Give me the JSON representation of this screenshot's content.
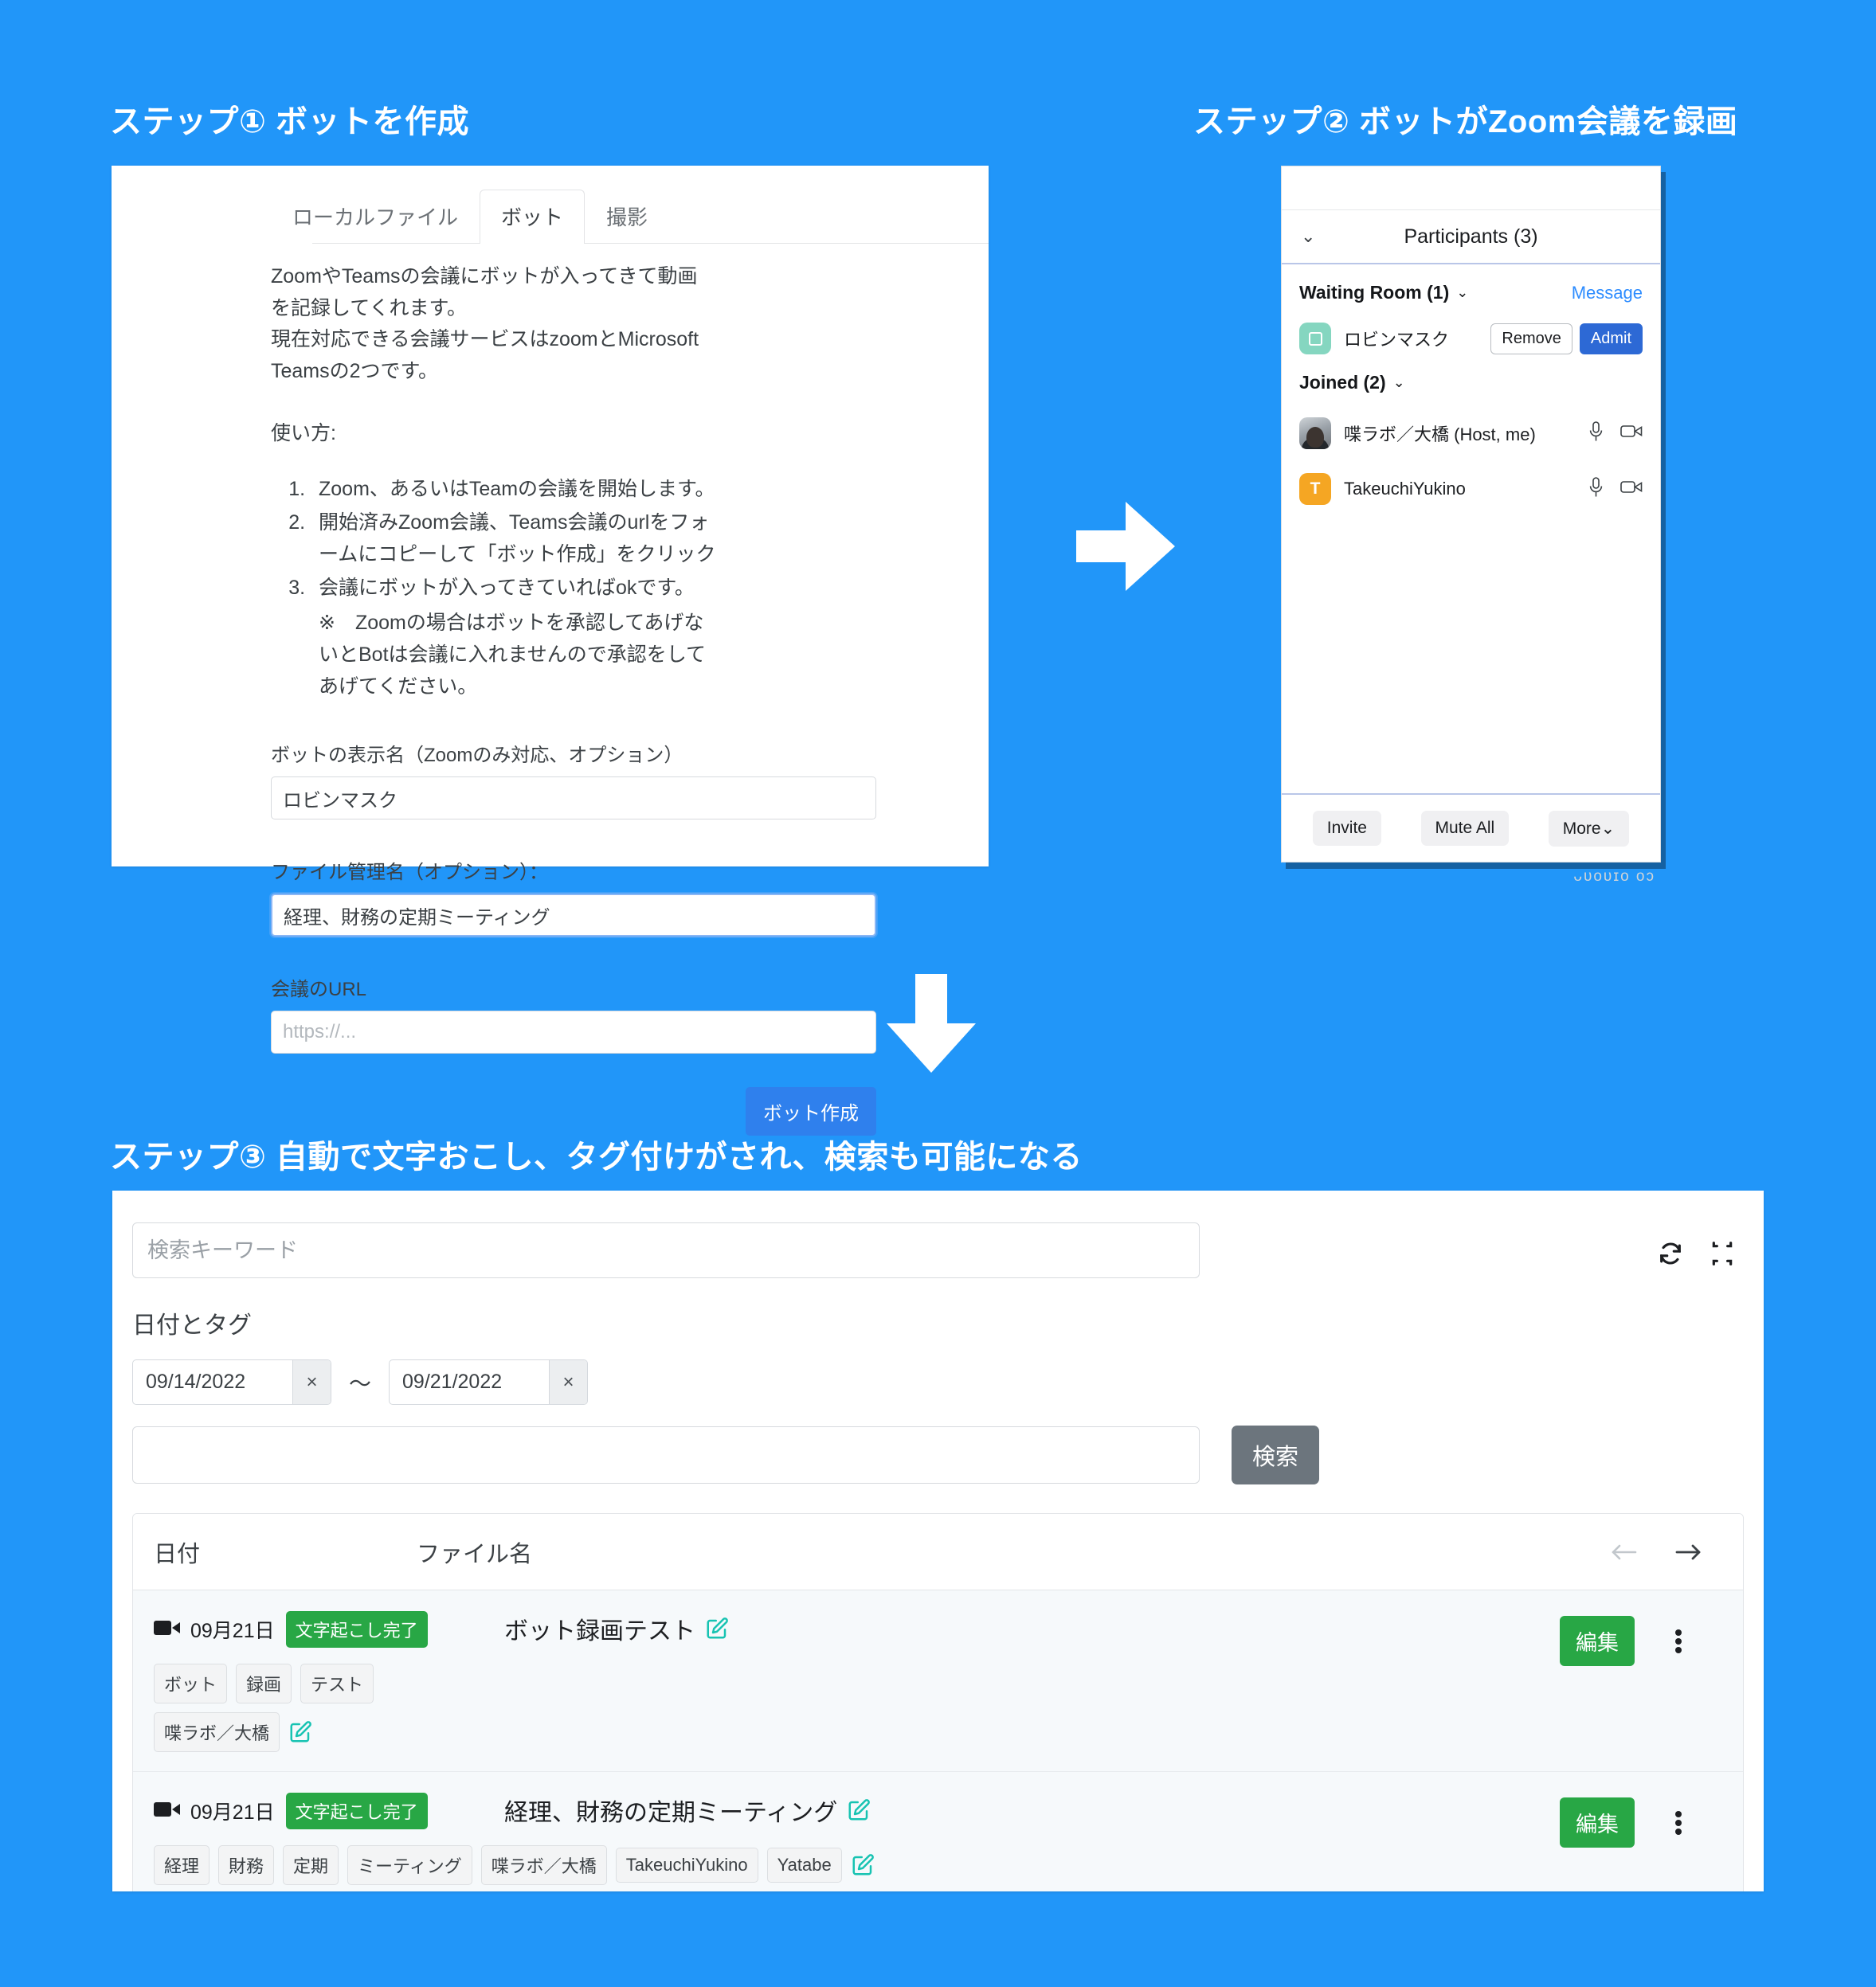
{
  "theme": {
    "background": "#2196f9",
    "accent_blue": "#2f80ed",
    "green": "#28a745",
    "gray_button": "#6c757d"
  },
  "steps": {
    "step1_heading": "ステップ① ボットを作成",
    "step2_heading": "ステップ② ボットがZoom会議を録画",
    "step3_heading": "ステップ③ 自動で文字おこし、タグ付けがされ、検索も可能になる"
  },
  "bot_form": {
    "tabs": [
      {
        "label": "ローカルファイル",
        "active": false
      },
      {
        "label": "ボット",
        "active": true
      },
      {
        "label": "撮影",
        "active": false
      }
    ],
    "intro_line1": "ZoomやTeamsの会議にボットが入ってきて動画を記録してくれます。",
    "intro_line2": "現在対応できる会議サービスはzoomとMicrosoft Teamsの2つです。",
    "howto_label": "使い方:",
    "steps_list": [
      "Zoom、あるいはTeamの会議を開始します。",
      "開始済みZoom会議、Teams会議のurlをフォームにコピーして「ボット作成」をクリック",
      "会議にボットが入ってきていればokです。"
    ],
    "step3_note": "※　Zoomの場合はボットを承認してあげないとBotは会議に入れませんので承認をしてあげてください。",
    "display_name_label": "ボットの表示名（Zoomのみ対応、オプション）",
    "display_name_value": "ロビンマスク",
    "file_name_label": "ファイル管理名（オプション）：",
    "file_name_value": "経理、財務の定期ミーティング",
    "meeting_url_label": "会議のURL",
    "meeting_url_placeholder": "https://...",
    "submit_label": "ボット作成"
  },
  "zoom_panel": {
    "title": "Participants (3)",
    "waiting_room_label": "Waiting Room (1)",
    "message_link": "Message",
    "waiting_participants": [
      {
        "name": "ロビンマスク",
        "remove_label": "Remove",
        "admit_label": "Admit"
      }
    ],
    "joined_label": "Joined (2)",
    "joined_participants": [
      {
        "name": "喋ラボ／大橋 (Host, me)",
        "avatar_type": "photo",
        "initial": ""
      },
      {
        "name": "TakeuchiYukino",
        "avatar_type": "orange",
        "initial": "T"
      }
    ],
    "footer_buttons": [
      "Invite",
      "Mute All",
      "More"
    ],
    "bleed_text": "ᴗᴜᴏᴜɪᴏ ᴏɔ"
  },
  "search_panel": {
    "keyword_placeholder": "検索キーワード",
    "keyword_value": "",
    "dates_tags_label": "日付とタグ",
    "date_from": "09/14/2022",
    "date_to": "09/21/2022",
    "date_separator": "～",
    "clear_label": "×",
    "tag_filter_value": "",
    "search_button_label": "検索",
    "table": {
      "columns": [
        "日付",
        "ファイル名"
      ],
      "rows": [
        {
          "date": "09月21日",
          "status": "文字起こし完了",
          "file_name": "ボット録画テスト",
          "tags": [
            "ボット",
            "録画",
            "テスト",
            "喋ラボ／大橋"
          ],
          "edit_label": "編集"
        },
        {
          "date": "09月21日",
          "status": "文字起こし完了",
          "file_name": "経理、財務の定期ミーティング",
          "tags": [
            "経理",
            "財務",
            "定期",
            "ミーティング",
            "喋ラボ／大橋",
            "TakeuchiYukino",
            "Yatabe"
          ],
          "edit_label": "編集"
        }
      ]
    }
  }
}
